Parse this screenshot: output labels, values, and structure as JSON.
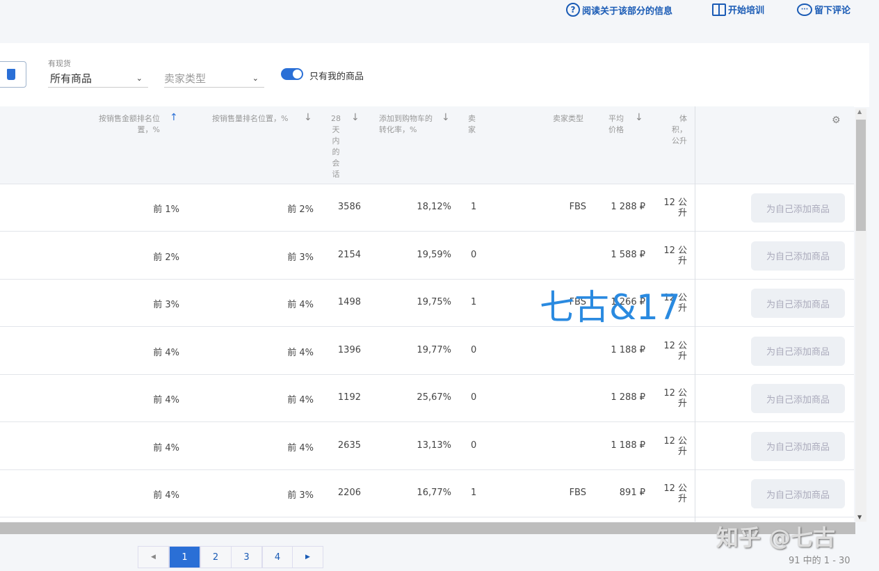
{
  "header": {
    "links": [
      {
        "label": "阅读关于该部分的信息",
        "icon": "help-circle-icon"
      },
      {
        "label": "开始培训",
        "icon": "book-icon"
      },
      {
        "label": "留下评论",
        "icon": "comment-icon"
      }
    ]
  },
  "filters": {
    "stock_label": "有现货",
    "stock_value": "所有商品",
    "seller_type_placeholder": "卖家类型",
    "toggle_label": "只有我的商品",
    "toggle_on": true
  },
  "columns": {
    "revenue_rank": "按销售金额排名位置，%",
    "sales_rank": "按销售量排名位置，%",
    "sessions": "28天内的会话",
    "cart_conv": "添加到购物车的转化率，%",
    "sellers": "卖家",
    "seller_type": "卖家类型",
    "avg_price": "平均价格",
    "volume": "体积，公升"
  },
  "rows": [
    {
      "revenue_rank": "前 1%",
      "sales_rank": "前 2%",
      "sessions": "3586",
      "cart_conv": "18,12%",
      "sellers": "1",
      "seller_type": "FBS",
      "avg_price": "1 288 ₽",
      "volume": "12 公升",
      "action": "为自己添加商品"
    },
    {
      "revenue_rank": "前 2%",
      "sales_rank": "前 3%",
      "sessions": "2154",
      "cart_conv": "19,59%",
      "sellers": "0",
      "seller_type": "",
      "avg_price": "1 588 ₽",
      "volume": "12 公升",
      "action": "为自己添加商品"
    },
    {
      "revenue_rank": "前 3%",
      "sales_rank": "前 4%",
      "sessions": "1498",
      "cart_conv": "19,75%",
      "sellers": "1",
      "seller_type": "FBS",
      "avg_price": "1 266 ₽",
      "volume": "12 公升",
      "action": "为自己添加商品"
    },
    {
      "revenue_rank": "前 4%",
      "sales_rank": "前 4%",
      "sessions": "1396",
      "cart_conv": "19,77%",
      "sellers": "0",
      "seller_type": "",
      "avg_price": "1 188 ₽",
      "volume": "12 公升",
      "action": "为自己添加商品"
    },
    {
      "revenue_rank": "前 4%",
      "sales_rank": "前 4%",
      "sessions": "1192",
      "cart_conv": "25,67%",
      "sellers": "0",
      "seller_type": "",
      "avg_price": "1 288 ₽",
      "volume": "12 公升",
      "action": "为自己添加商品"
    },
    {
      "revenue_rank": "前 4%",
      "sales_rank": "前 4%",
      "sessions": "2635",
      "cart_conv": "13,13%",
      "sellers": "0",
      "seller_type": "",
      "avg_price": "1 188 ₽",
      "volume": "12 公升",
      "action": "为自己添加商品"
    },
    {
      "revenue_rank": "前 4%",
      "sales_rank": "前 3%",
      "sessions": "2206",
      "cart_conv": "16,77%",
      "sellers": "1",
      "seller_type": "FBS",
      "avg_price": "891 ₽",
      "volume": "12 公升",
      "action": "为自己添加商品"
    }
  ],
  "pagination": {
    "pages": [
      "1",
      "2",
      "3",
      "4"
    ],
    "current": "1",
    "summary": "91 中的 1 - 30"
  },
  "watermarks": [
    "七古&17",
    "知乎 @七古"
  ]
}
